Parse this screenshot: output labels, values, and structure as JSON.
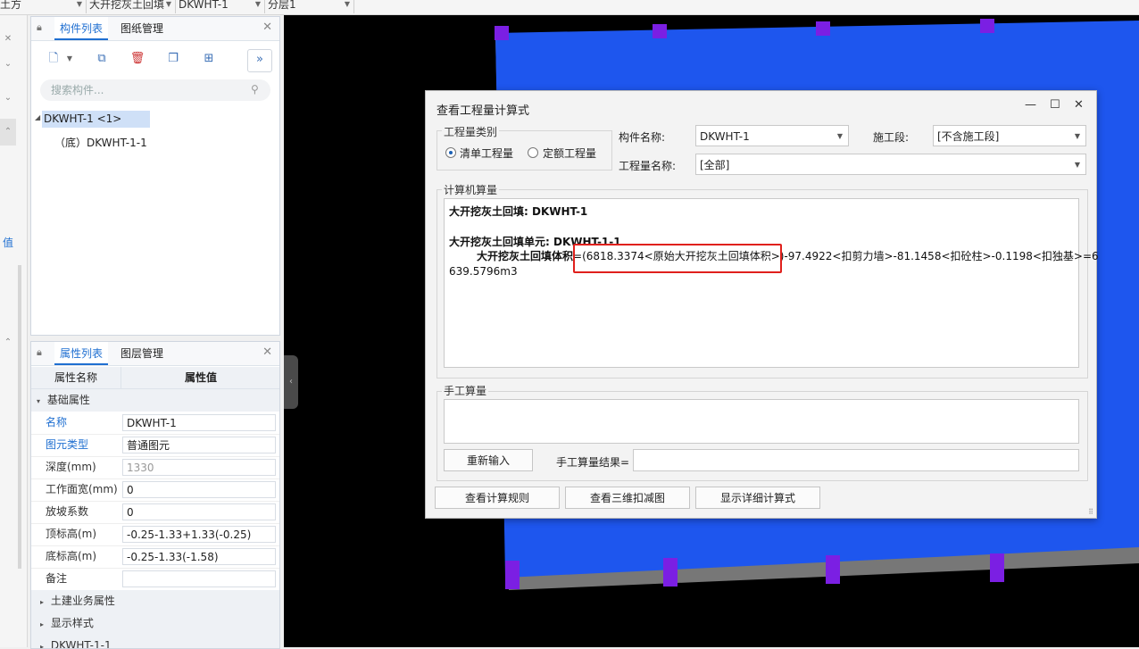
{
  "topbar": {
    "sel1": "土方",
    "sel2": "大开挖灰土回填",
    "sel3": "DKWHT-1",
    "sel4": "分层1"
  },
  "leftstrip": {
    "value_char": "值"
  },
  "component_panel": {
    "tabs": [
      "构件列表",
      "图纸管理"
    ],
    "search_placeholder": "搜索构件...",
    "tree": {
      "root": "DKWHT-1 <1>",
      "child": "（底）DKWHT-1-1"
    }
  },
  "property_panel": {
    "tabs": [
      "属性列表",
      "图层管理"
    ],
    "header": {
      "name": "属性名称",
      "value": "属性值"
    },
    "group_basic": "基础属性",
    "rows": [
      {
        "name": "名称",
        "value": "DKWHT-1"
      },
      {
        "name": "图元类型",
        "value": "普通图元"
      },
      {
        "name": "深度(mm)",
        "value": "1330"
      },
      {
        "name": "工作面宽(mm)",
        "value": "0"
      },
      {
        "name": "放坡系数",
        "value": "0"
      },
      {
        "name": "顶标高(m)",
        "value": "-0.25-1.33+1.33(-0.25)"
      },
      {
        "name": "底标高(m)",
        "value": "-0.25-1.33(-1.58)"
      },
      {
        "name": "备注",
        "value": ""
      }
    ],
    "groups_collapsed": [
      "土建业务属性",
      "显示样式",
      "DKWHT-1-1"
    ]
  },
  "dialog": {
    "title": "查看工程量计算式",
    "qty_type_label": "工程量类别",
    "radio_list": "清单工程量",
    "radio_quota": "定额工程量",
    "comp_name_label": "构件名称:",
    "comp_name_value": "DKWHT-1",
    "stage_label": "施工段:",
    "stage_value": "[不含施工段]",
    "qty_name_label": "工程量名称:",
    "qty_name_value": "[全部]",
    "computer_calc_label": "计算机算量",
    "calc_line1": "大开挖灰土回填: DKWHT-1",
    "calc_line2": "大开挖灰土回填单元: DKWHT-1-1",
    "calc_line3_label": "大开挖灰土回填体积",
    "calc_line3_formula": "=(6818.3374<原始大开挖灰土回填体积>)-97.4922<扣剪力墙>-81.1458<扣砼柱>-0.1198<扣独基>=6",
    "calc_line4": "639.5796m3",
    "manual_calc_label": "手工算量",
    "reinput_button": "重新输入",
    "manual_result_label": "手工算量结果=",
    "btn_rules": "查看计算规则",
    "btn_3d": "查看三维扣减图",
    "btn_detail": "显示详细计算式"
  }
}
